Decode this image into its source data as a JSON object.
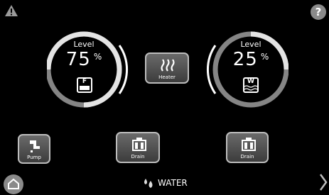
{
  "header": {
    "warning_icon": "warning-triangle-icon",
    "help_label": "?"
  },
  "tanks": [
    {
      "level_label": "Level",
      "level_value": "75",
      "unit": "%",
      "tank_letter": "F",
      "fill": 0.75
    },
    {
      "level_label": "Level",
      "level_value": "25",
      "unit": "%",
      "tank_letter": "W",
      "fill": 0.25
    }
  ],
  "controls": {
    "heater_label": "Heater",
    "pump_label": "Pump",
    "drain_fresh_label": "Drain",
    "drain_waste_label": "Drain"
  },
  "footer": {
    "section_title": "WATER",
    "home_icon": "home-icon",
    "next_icon": "chevron-right-icon"
  },
  "colors": {
    "ring_track": "#8a8a8a",
    "ring_fill": "#e6e6e6",
    "tile_border": "#bdbdbd"
  }
}
